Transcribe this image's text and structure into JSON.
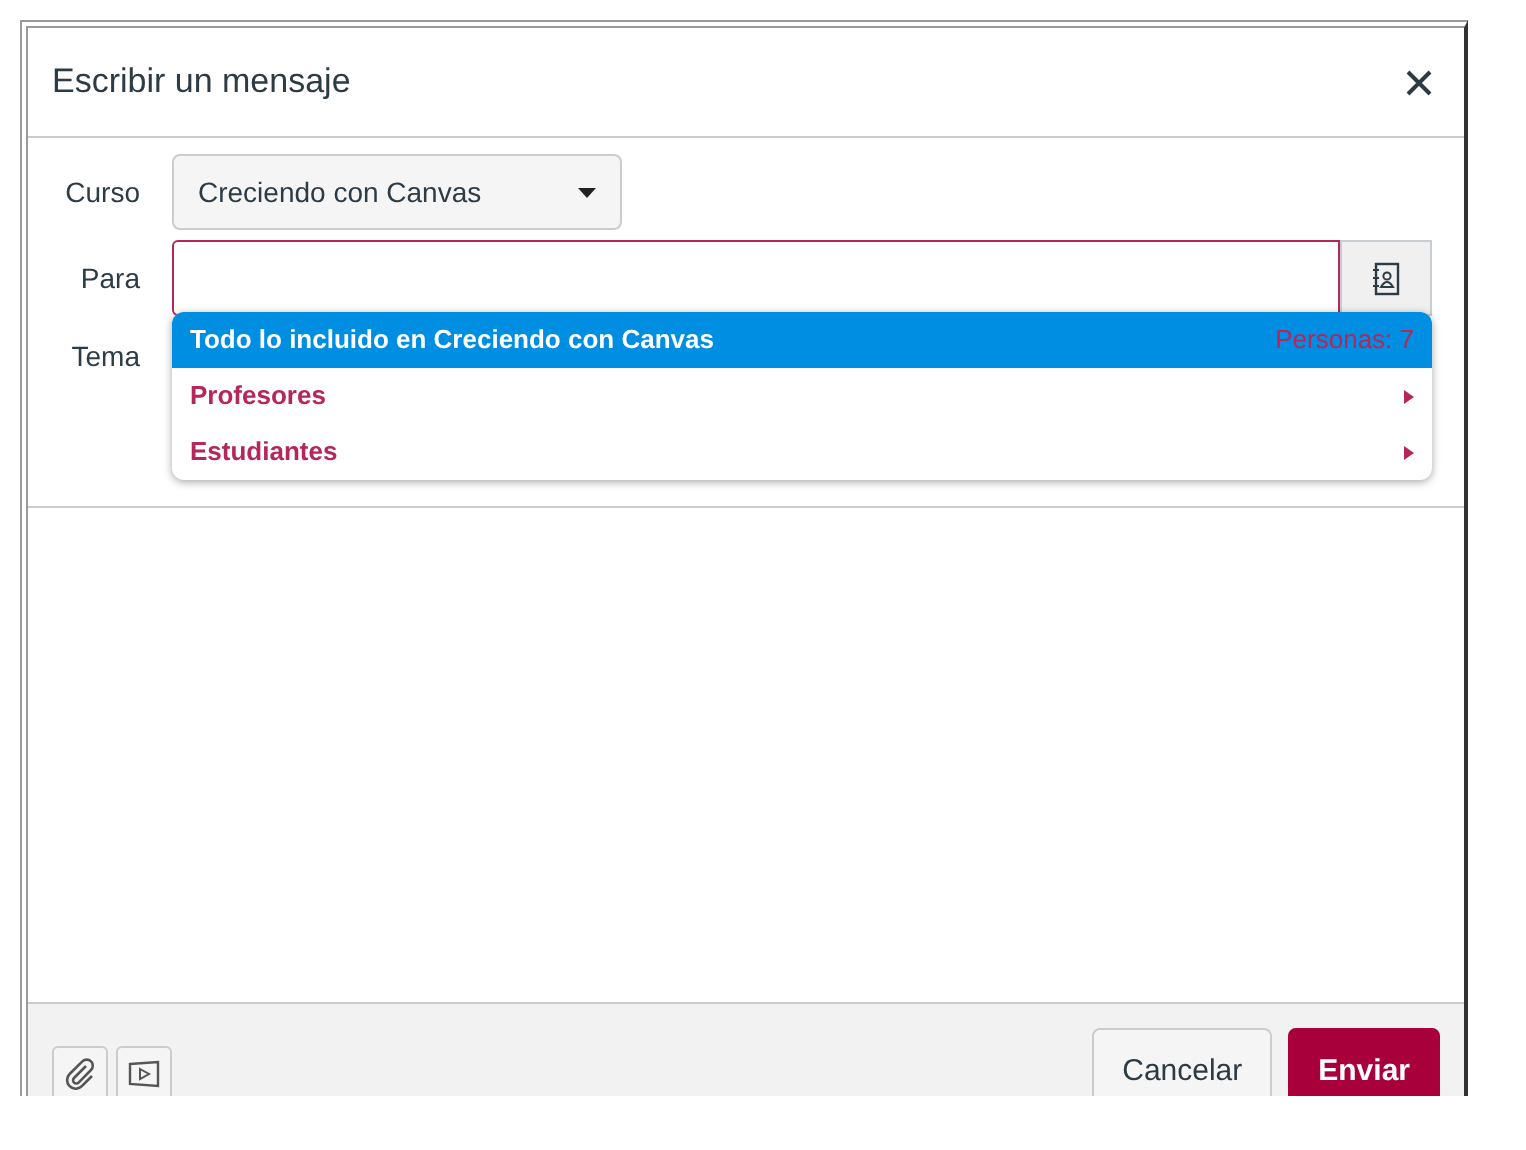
{
  "dialog": {
    "title": "Escribir un mensaje"
  },
  "form": {
    "course_label": "Curso",
    "course_value": "Creciendo con Canvas",
    "to_label": "Para",
    "subject_label": "Tema"
  },
  "recipient_menu": [
    {
      "label": "Todo lo incluido en Creciendo con Canvas",
      "count": "Personas: 7",
      "selected": true,
      "kind": "all"
    },
    {
      "label": "Profesores",
      "selected": false,
      "kind": "group"
    },
    {
      "label": "Estudiantes",
      "selected": false,
      "kind": "group"
    }
  ],
  "footer": {
    "buttons": [
      {
        "label": "Cancelar",
        "kind": "secondary"
      },
      {
        "label": "Enviar",
        "kind": "primary"
      }
    ]
  }
}
